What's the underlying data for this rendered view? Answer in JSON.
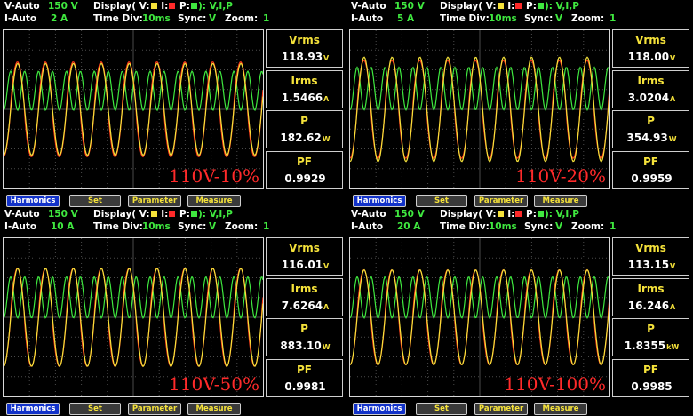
{
  "colors": {
    "voltage": "#f5e23a",
    "current": "#ff3a1a",
    "power": "#3fe83f",
    "overlay": "#ff2a2a",
    "button_active": "#1232c9"
  },
  "icons": {
    "v_legend": "yellow-square",
    "i_legend": "red-square",
    "p_legend": "green-square"
  },
  "panels": [
    {
      "v_mode": "V-Auto",
      "v_range": "150 V",
      "i_mode": "I-Auto",
      "i_range": "2 A",
      "display_label": "Display( V:",
      "legend_i": "I:",
      "legend_p": "P:",
      "display_value": "):  V,I,P",
      "time_div_label": "Time Div:",
      "time_div": "10ms",
      "sync_label": "Sync:",
      "sync": "V",
      "zoom_label": "Zoom:",
      "zoom": "1",
      "overlay": "110V-10%",
      "measurements": [
        {
          "label": "Vrms",
          "value": "118.93",
          "unit": "V"
        },
        {
          "label": "Irms",
          "value": "1.5466",
          "unit": "A"
        },
        {
          "label": "P",
          "value": "182.62",
          "unit": "W"
        },
        {
          "label": "PF",
          "value": "0.9929",
          "unit": ""
        }
      ],
      "buttons": [
        "Harmonics",
        "Set",
        "Parameter",
        "Measure"
      ],
      "waveform": {
        "v_amp": 0.58,
        "i_amp": 0.6,
        "p_amp": 0.55,
        "cycles": 9.3
      }
    },
    {
      "v_mode": "V-Auto",
      "v_range": "150 V",
      "i_mode": "I-Auto",
      "i_range": "5 A",
      "display_label": "Display( V:",
      "legend_i": "I:",
      "legend_p": "P:",
      "display_value": "):  V,I,P",
      "time_div_label": "Time Div:",
      "time_div": "10ms",
      "sync_label": "Sync:",
      "sync": "V",
      "zoom_label": "Zoom:",
      "zoom": "1",
      "overlay": "110V-20%",
      "measurements": [
        {
          "label": "Vrms",
          "value": "118.00",
          "unit": "V"
        },
        {
          "label": "Irms",
          "value": "3.0204",
          "unit": "A"
        },
        {
          "label": "P",
          "value": "354.93",
          "unit": "W"
        },
        {
          "label": "PF",
          "value": "0.9959",
          "unit": ""
        }
      ],
      "buttons": [
        "Harmonics",
        "Set",
        "Parameter",
        "Measure"
      ],
      "waveform": {
        "v_amp": 0.66,
        "i_amp": 0.62,
        "p_amp": 0.6,
        "cycles": 9.3
      }
    },
    {
      "v_mode": "V-Auto",
      "v_range": "150 V",
      "i_mode": "I-Auto",
      "i_range": "10 A",
      "display_label": "Display( V:",
      "legend_i": "I:",
      "legend_p": "P:",
      "display_value": "):  V,I,P",
      "time_div_label": "Time Div:",
      "time_div": "10ms",
      "sync_label": "Sync:",
      "sync": "V",
      "zoom_label": "Zoom:",
      "zoom": "1",
      "overlay": "110V-50%",
      "measurements": [
        {
          "label": "Vrms",
          "value": "116.01",
          "unit": "V"
        },
        {
          "label": "Irms",
          "value": "7.6264",
          "unit": "A"
        },
        {
          "label": "P",
          "value": "883.10",
          "unit": "W"
        },
        {
          "label": "PF",
          "value": "0.9981",
          "unit": ""
        }
      ],
      "buttons": [
        "Harmonics",
        "Set",
        "Parameter",
        "Measure"
      ],
      "waveform": {
        "v_amp": 0.62,
        "i_amp": 0.62,
        "p_amp": 0.58,
        "cycles": 9.3
      }
    },
    {
      "v_mode": "V-Auto",
      "v_range": "150 V",
      "i_mode": "I-Auto",
      "i_range": "20 A",
      "display_label": "Display( V:",
      "legend_i": "I:",
      "legend_p": "P:",
      "display_value": "):  V,I,P",
      "time_div_label": "Time Div:",
      "time_div": "10ms",
      "sync_label": "Sync:",
      "sync": "V",
      "zoom_label": "Zoom:",
      "zoom": "1",
      "overlay": "110V-100%",
      "measurements": [
        {
          "label": "Vrms",
          "value": "113.15",
          "unit": "V"
        },
        {
          "label": "Irms",
          "value": "16.246",
          "unit": "A"
        },
        {
          "label": "P",
          "value": "1.8355",
          "unit": "kW"
        },
        {
          "label": "PF",
          "value": "0.9985",
          "unit": ""
        }
      ],
      "buttons": [
        "Harmonics",
        "Set",
        "Parameter",
        "Measure"
      ],
      "waveform": {
        "v_amp": 0.6,
        "i_amp": 0.6,
        "p_amp": 0.58,
        "cycles": 9.3
      }
    }
  ]
}
